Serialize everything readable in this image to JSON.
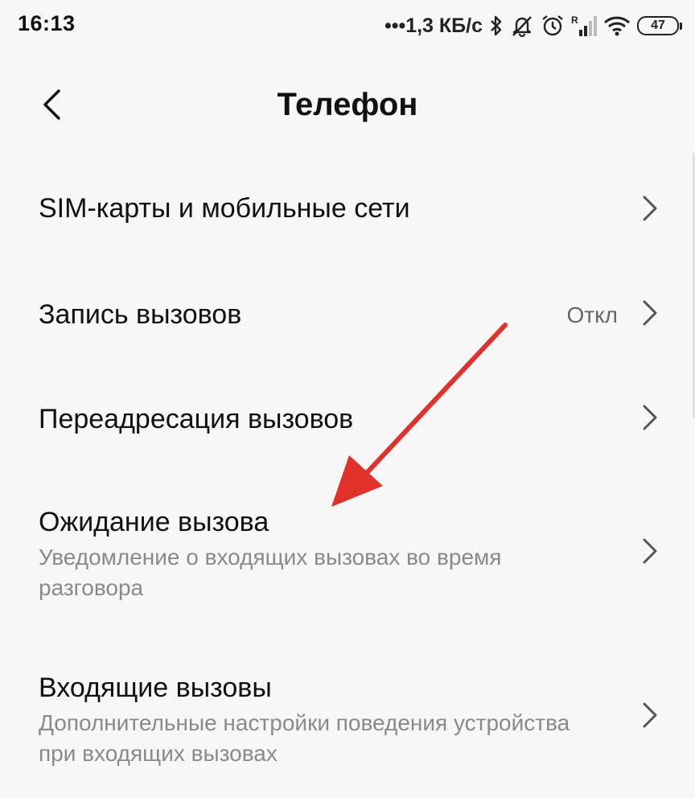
{
  "status_bar": {
    "time": "16:13",
    "speed": "•••1,3 КБ/с",
    "battery": "47",
    "icons": [
      "bluetooth-icon",
      "mute-bell-icon",
      "alarm-icon",
      "signal-roaming-icon",
      "wifi-icon",
      "battery-icon"
    ]
  },
  "header": {
    "title": "Телефон",
    "back_icon": "chevron-left-icon"
  },
  "settings": {
    "items": [
      {
        "title": "SIM-карты и мобильные сети"
      },
      {
        "title": "Запись вызовов",
        "value": "Откл"
      },
      {
        "title": "Переадресация вызовов"
      },
      {
        "title": "Ожидание вызова",
        "subtitle": "Уведомление о входящих вызовах во время разговора"
      },
      {
        "title": "Входящие вызовы",
        "subtitle": "Дополнительные настройки поведения устройства при входящих вызовах"
      }
    ],
    "chevron_icon": "chevron-right-icon"
  },
  "annotation": {
    "color": "#e0322b"
  },
  "colors": {
    "background": "#f7f7f7",
    "title_text": "#111111",
    "subtitle_text": "#8a8a8a"
  }
}
